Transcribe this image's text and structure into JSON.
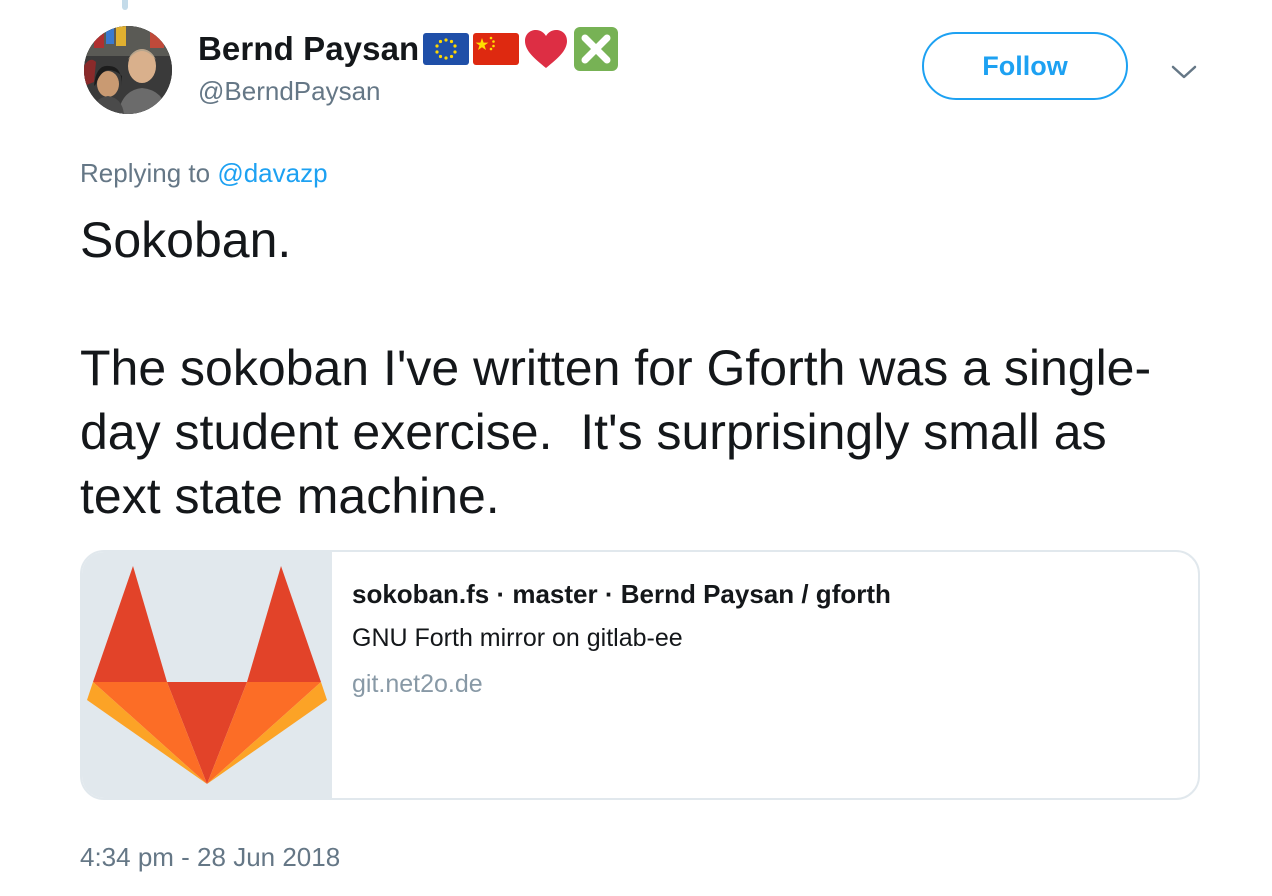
{
  "author": {
    "display_name": "Bernd Paysan",
    "handle": "@BerndPaysan",
    "name_emojis": [
      "eu-flag-icon",
      "china-flag-icon",
      "red-heart-icon",
      "cross-mark-button-icon"
    ]
  },
  "actions": {
    "follow_label": "Follow",
    "more_icon": "chevron-down-icon"
  },
  "reply": {
    "prefix": "Replying to ",
    "mention": "@davazp"
  },
  "tweet": {
    "text": "Sokoban.\n\nThe sokoban I've written for Gforth was a single-day student exercise.  It's surprisingly small as text state machine."
  },
  "card": {
    "title": "sokoban.fs · master · Bernd Paysan / gforth",
    "description": "GNU Forth mirror on gitlab-ee",
    "domain": "git.net2o.de",
    "image_icon": "gitlab-fox-logo"
  },
  "timestamp": "4:34 pm - 28 Jun 2018",
  "colors": {
    "accent": "#1da1f2",
    "secondary_text": "#657786",
    "primary_text": "#14171a",
    "card_border": "#e1e8ed",
    "card_domain": "#8899a6"
  }
}
